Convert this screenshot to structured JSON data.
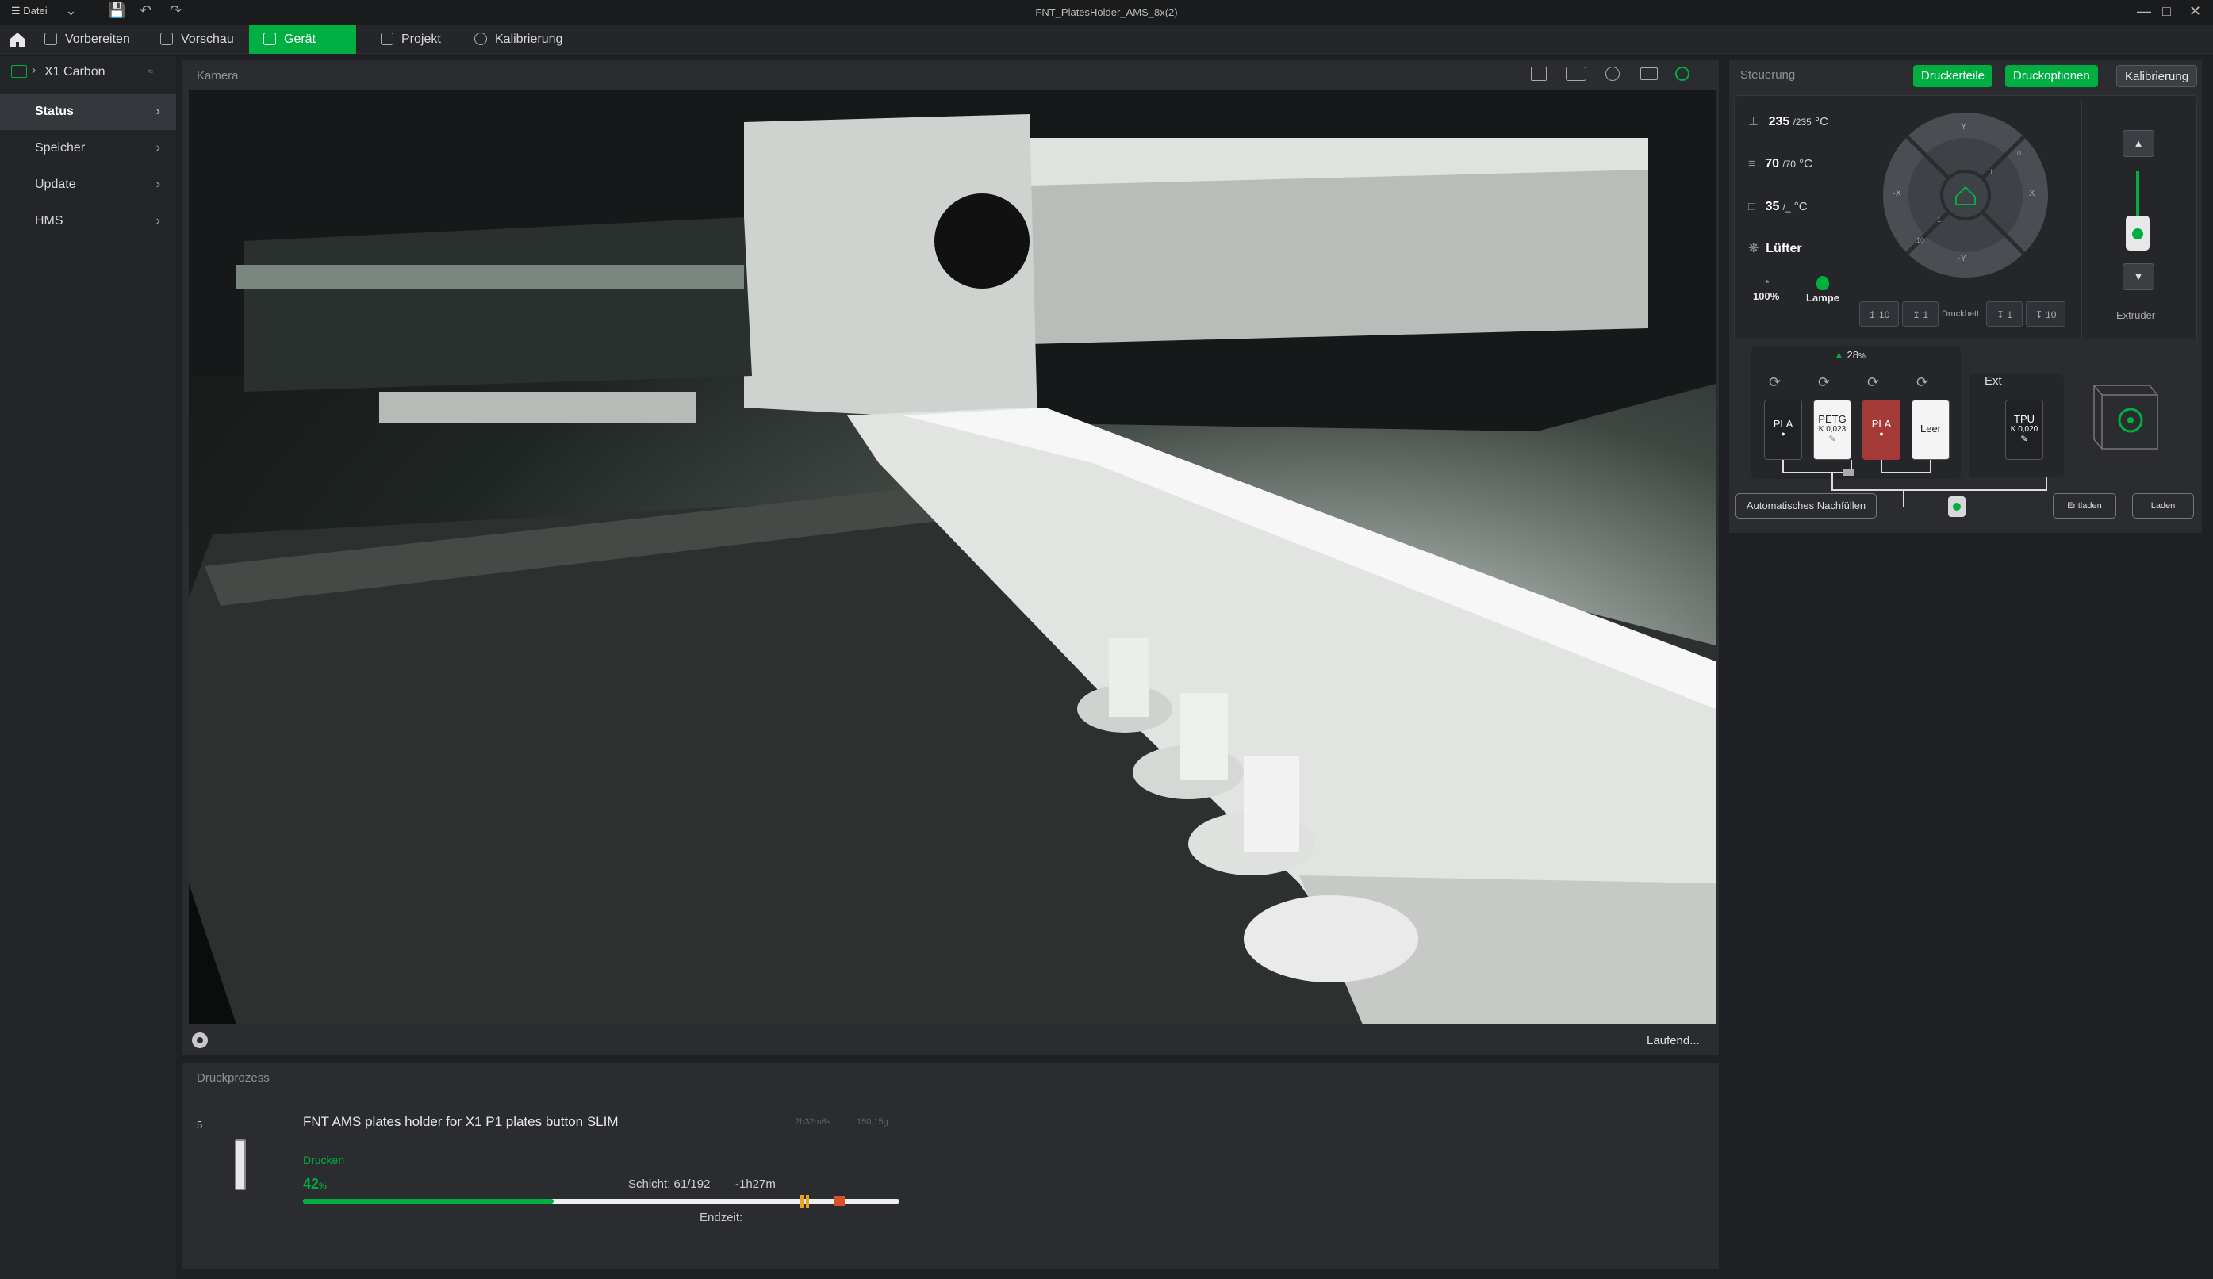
{
  "titlebar": {
    "menu_label": "Datei",
    "window_title": "FNT_PlatesHolder_AMS_8x(2)"
  },
  "nav": {
    "prepare": "Vorbereiten",
    "preview": "Vorschau",
    "device": "Gerät",
    "project": "Projekt",
    "calibration": "Kalibrierung"
  },
  "sidebar": {
    "printer_name": "X1 Carbon",
    "items": [
      {
        "label": "Status",
        "active": true
      },
      {
        "label": "Speicher"
      },
      {
        "label": "Update"
      },
      {
        "label": "HMS"
      }
    ]
  },
  "camera": {
    "title": "Kamera",
    "status": "Laufend..."
  },
  "print_process": {
    "title": "Druckprozess",
    "plate_number": "5",
    "job_name": "FNT AMS plates holder for X1 P1 plates button SLIM",
    "duration": "2h32m6s",
    "weight": "150,15g",
    "state": "Drucken",
    "progress_value": "42",
    "progress_unit": "%",
    "progress_fraction": 0.42,
    "layer": "Schicht: 61/192",
    "remaining": "-1h27m",
    "end_time_label": "Endzeit:"
  },
  "control": {
    "title": "Steuerung",
    "buttons": {
      "parts": "Druckerteile",
      "options": "Druckoptionen",
      "calibration": "Kalibrierung"
    },
    "nozzle": {
      "current": "235",
      "target": "/235",
      "unit": "°C"
    },
    "bed": {
      "current": "70",
      "target": "/70",
      "unit": "°C"
    },
    "chamber": {
      "current": "35",
      "target": "/_",
      "unit": "°C"
    },
    "fan_label": "Lüfter",
    "speed_value": "100%",
    "lamp_label": "Lampe",
    "jog_labels": {
      "y_plus": "Y",
      "y_minus": "-Y",
      "x_plus": "X",
      "x_minus": "-X",
      "ring_10a": "10",
      "ring_1a": "1",
      "ring_1b": "1",
      "ring_10b": "10"
    },
    "bed_buttons": {
      "up10": "10",
      "up1": "1",
      "label": "Druckbett",
      "down1": "1",
      "down10": "10"
    },
    "extruder_label": "Extruder"
  },
  "ams": {
    "humidity": "28",
    "humidity_unit": "%",
    "slots": [
      {
        "material": "PLA",
        "k": "",
        "color": "#1f2124",
        "text": "#fff"
      },
      {
        "material": "PETG",
        "k": "K 0,023",
        "color": "#f4f4f4",
        "text": "#222"
      },
      {
        "material": "PLA",
        "k": "",
        "color": "#a43a38",
        "text": "#fff"
      },
      {
        "material": "Leer",
        "k": "",
        "color": "#f4f4f4",
        "text": "#222"
      }
    ],
    "ext_label": "Ext",
    "ext_slot": {
      "material": "TPU",
      "k": "K 0,020"
    },
    "auto_refill": "Automatisches Nachfüllen",
    "unload": "Entladen",
    "load": "Laden"
  }
}
